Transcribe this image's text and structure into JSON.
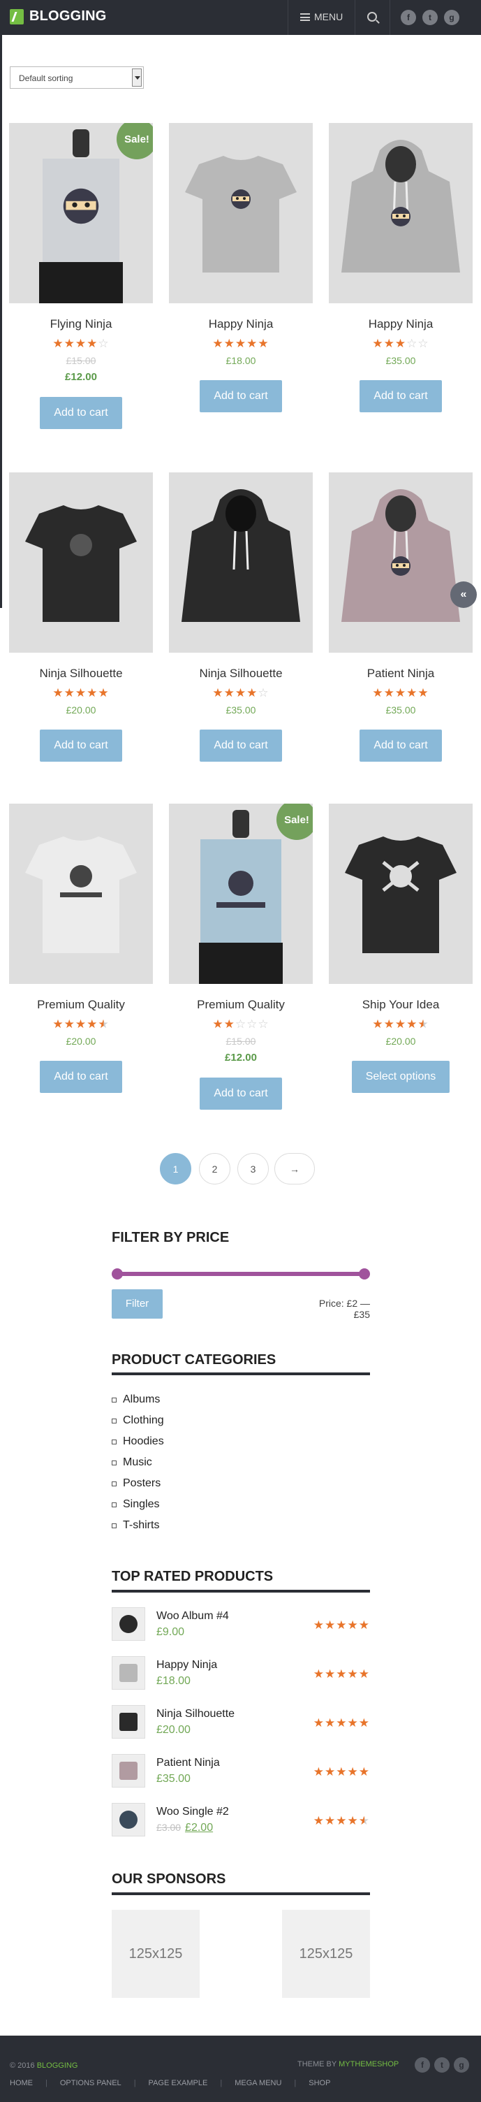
{
  "header": {
    "logo": "BLOGGING",
    "menu_label": "MENU",
    "social": [
      {
        "icon": "facebook-icon",
        "glyph": "f"
      },
      {
        "icon": "twitter-icon",
        "glyph": "t"
      },
      {
        "icon": "google-plus-icon",
        "glyph": "g"
      }
    ]
  },
  "sorting": {
    "selected": "Default sorting"
  },
  "products": [
    {
      "name": "Flying Ninja",
      "rating": 4,
      "old_price": "£15.00",
      "price": "£12.00",
      "button": "Add to cart",
      "sale": "Sale!",
      "image": "poster-ninja"
    },
    {
      "name": "Happy Ninja",
      "rating": 5,
      "price": "£18.00",
      "button": "Add to cart",
      "image": "grey-tshirt-ninja"
    },
    {
      "name": "Happy Ninja",
      "rating": 3,
      "price": "£35.00",
      "button": "Add to cart",
      "image": "grey-hoodie-ninja"
    },
    {
      "name": "Ninja Silhouette",
      "rating": 5,
      "price": "£20.00",
      "button": "Add to cart",
      "image": "black-tshirt-silhouette"
    },
    {
      "name": "Ninja Silhouette",
      "rating": 4,
      "price": "£35.00",
      "button": "Add to cart",
      "image": "black-hoodie"
    },
    {
      "name": "Patient Ninja",
      "rating": 5,
      "price": "£35.00",
      "button": "Add to cart",
      "image": "pink-hoodie"
    },
    {
      "name": "Premium Quality",
      "rating": 4.5,
      "price": "£20.00",
      "button": "Add to cart",
      "image": "white-tshirt-woothemes"
    },
    {
      "name": "Premium Quality",
      "rating": 2,
      "old_price": "£15.00",
      "price": "£12.00",
      "button": "Add to cart",
      "sale": "Sale!",
      "image": "poster-woothemes"
    },
    {
      "name": "Ship Your Idea",
      "rating": 4.5,
      "price": "£20.00",
      "button": "Select options",
      "image": "black-tshirt-skull"
    }
  ],
  "pagination": {
    "pages": [
      "1",
      "2",
      "3"
    ],
    "next": "→",
    "active": "1"
  },
  "filter_by_price": {
    "title": "FILTER BY PRICE",
    "button": "Filter",
    "range_label": "Price: £2 — £35"
  },
  "product_categories": {
    "title": "PRODUCT CATEGORIES",
    "items": [
      "Albums",
      "Clothing",
      "Hoodies",
      "Music",
      "Posters",
      "Singles",
      "T-shirts"
    ]
  },
  "top_rated": {
    "title": "TOP RATED PRODUCTS",
    "items": [
      {
        "name": "Woo Album #4",
        "price": "£9.00",
        "rating": 5,
        "thumb": "album-icon"
      },
      {
        "name": "Happy Ninja",
        "price": "£18.00",
        "rating": 5,
        "thumb": "grey-tshirt-icon"
      },
      {
        "name": "Ninja Silhouette",
        "price": "£20.00",
        "rating": 5,
        "thumb": "black-tshirt-icon"
      },
      {
        "name": "Patient Ninja",
        "price": "£35.00",
        "rating": 5,
        "thumb": "pink-hoodie-icon"
      },
      {
        "name": "Woo Single #2",
        "old_price": "£3.00",
        "price": "£2.00",
        "rating": 4.5,
        "thumb": "single-icon"
      }
    ]
  },
  "sponsors": {
    "title": "OUR SPONSORS",
    "items": [
      "125x125",
      "125x125"
    ]
  },
  "footer": {
    "copyright_prefix": "© 2016",
    "copyright_brand": "BLOGGING",
    "theme_by_prefix": "THEME BY",
    "theme_by_brand": "MYTHEMESHOP",
    "nav": [
      "HOME",
      "OPTIONS PANEL",
      "PAGE EXAMPLE",
      "MEGA MENU",
      "SHOP"
    ]
  },
  "colors": {
    "header_bg": "#2b2e35",
    "brand_green": "#74bd43",
    "button_blue": "#8ab9d8",
    "star_orange": "#e8742a",
    "price_green": "#72a856",
    "slider_purple": "#a0539c",
    "sale_green": "#74a15c"
  },
  "back_to_top": "«"
}
